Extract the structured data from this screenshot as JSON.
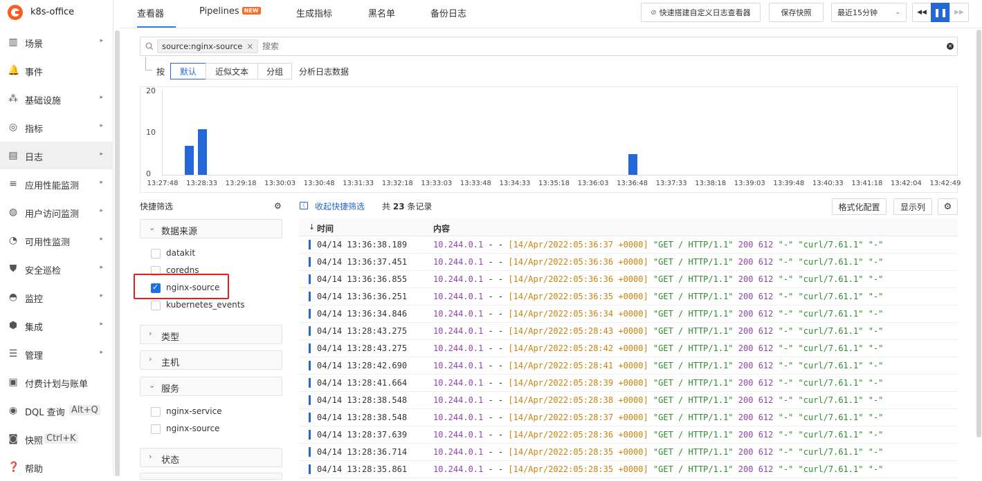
{
  "app": {
    "title": "k8s-office"
  },
  "sidebar": {
    "items": [
      {
        "label": "场景",
        "arrow": "▸"
      },
      {
        "label": "事件",
        "arrow": ""
      },
      {
        "label": "基础设施",
        "arrow": "▸"
      },
      {
        "label": "指标",
        "arrow": "▸"
      },
      {
        "label": "日志",
        "arrow": "▸"
      },
      {
        "label": "应用性能监测",
        "arrow": "▸"
      },
      {
        "label": "用户访问监测",
        "arrow": "▸"
      },
      {
        "label": "可用性监测",
        "arrow": "▸"
      },
      {
        "label": "安全巡检",
        "arrow": "▸"
      },
      {
        "label": "监控",
        "arrow": "▸"
      },
      {
        "label": "集成",
        "arrow": "▸"
      },
      {
        "label": "管理",
        "arrow": "▸"
      },
      {
        "label": "付费计划与账单",
        "arrow": ""
      },
      {
        "label": "DQL 查询",
        "shortcut": "Alt+Q",
        "arrow": ""
      },
      {
        "label": "快照",
        "shortcut": "Ctrl+K",
        "arrow": ""
      },
      {
        "label": "帮助",
        "arrow": ""
      }
    ],
    "active_index": 4
  },
  "header": {
    "tabs": [
      "查看器",
      "Pipelines",
      "生成指标",
      "黑名单",
      "备份日志"
    ],
    "new_badge": "NEW",
    "quick_build": "快速搭建自定义日志查看器",
    "save_snapshot": "保存快照",
    "time_range": "最近15分钟"
  },
  "search": {
    "tag": "source:nginx-source",
    "placeholder": "搜索"
  },
  "analysis": {
    "prefix": "按",
    "modes": [
      "默认",
      "近似文本",
      "分组"
    ],
    "suffix": "分析日志数据"
  },
  "chart_data": {
    "type": "bar",
    "yticks": [
      "20",
      "10",
      "0"
    ],
    "ylim": [
      0,
      20
    ],
    "xticks": [
      "13:27:48",
      "13:28:33",
      "13:29:18",
      "13:30:03",
      "13:30:48",
      "13:31:33",
      "13:32:18",
      "13:33:03",
      "13:33:48",
      "13:34:33",
      "13:35:18",
      "13:36:03",
      "13:36:48",
      "13:37:33",
      "13:38:18",
      "13:39:03",
      "13:39:48",
      "13:40:33",
      "13:41:18",
      "13:42:04",
      "13:42:49"
    ],
    "bars": [
      {
        "x": "13:28:18",
        "value": 7
      },
      {
        "x": "13:28:33",
        "value": 11
      },
      {
        "x": "13:36:48",
        "value": 5
      }
    ],
    "color": "#2467d6"
  },
  "quick_filter": {
    "title": "快捷筛选",
    "groups": [
      {
        "title": "数据来源",
        "expanded": true,
        "items": [
          {
            "label": "datakit",
            "checked": false
          },
          {
            "label": "coredns",
            "checked": false
          },
          {
            "label": "nginx-source",
            "checked": true
          },
          {
            "label": "kubernetes_events",
            "checked": false
          }
        ]
      },
      {
        "title": "类型",
        "expanded": false
      },
      {
        "title": "主机",
        "expanded": false
      },
      {
        "title": "服务",
        "expanded": true,
        "items": [
          {
            "label": "nginx-service",
            "checked": false
          },
          {
            "label": "nginx-source",
            "checked": false
          }
        ]
      },
      {
        "title": "状态",
        "expanded": false
      }
    ]
  },
  "logs": {
    "collapse_label": "收起快捷筛选",
    "count_prefix": "共",
    "count": "23",
    "count_suffix": "条记录",
    "format_button": "格式化配置",
    "columns_button": "显示列",
    "columns": [
      "时间",
      "内容"
    ],
    "rows": [
      {
        "time": "04/14 13:36:38.189",
        "ip": "10.244.0.1",
        "ts": "[14/Apr/2022:05:36:37 +0000]"
      },
      {
        "time": "04/14 13:36:37.451",
        "ip": "10.244.0.1",
        "ts": "[14/Apr/2022:05:36:36 +0000]"
      },
      {
        "time": "04/14 13:36:36.855",
        "ip": "10.244.0.1",
        "ts": "[14/Apr/2022:05:36:36 +0000]"
      },
      {
        "time": "04/14 13:36:36.251",
        "ip": "10.244.0.1",
        "ts": "[14/Apr/2022:05:36:35 +0000]"
      },
      {
        "time": "04/14 13:36:34.846",
        "ip": "10.244.0.1",
        "ts": "[14/Apr/2022:05:36:34 +0000]"
      },
      {
        "time": "04/14 13:28:43.275",
        "ip": "10.244.0.1",
        "ts": "[14/Apr/2022:05:28:43 +0000]"
      },
      {
        "time": "04/14 13:28:43.275",
        "ip": "10.244.0.1",
        "ts": "[14/Apr/2022:05:28:42 +0000]"
      },
      {
        "time": "04/14 13:28:42.690",
        "ip": "10.244.0.1",
        "ts": "[14/Apr/2022:05:28:41 +0000]"
      },
      {
        "time": "04/14 13:28:41.664",
        "ip": "10.244.0.1",
        "ts": "[14/Apr/2022:05:28:39 +0000]"
      },
      {
        "time": "04/14 13:28:38.548",
        "ip": "10.244.0.1",
        "ts": "[14/Apr/2022:05:28:38 +0000]"
      },
      {
        "time": "04/14 13:28:38.548",
        "ip": "10.244.0.1",
        "ts": "[14/Apr/2022:05:28:37 +0000]"
      },
      {
        "time": "04/14 13:28:37.639",
        "ip": "10.244.0.1",
        "ts": "[14/Apr/2022:05:28:36 +0000]"
      },
      {
        "time": "04/14 13:28:36.714",
        "ip": "10.244.0.1",
        "ts": "[14/Apr/2022:05:28:35 +0000]"
      },
      {
        "time": "04/14 13:28:35.861",
        "ip": "10.244.0.1",
        "ts": "[14/Apr/2022:05:28:35 +0000]"
      }
    ],
    "dash": "- -",
    "request": "\"GET / HTTP/1.1\"",
    "status": "200",
    "bytes": "612",
    "referer": "\"-\"",
    "agent": "\"curl/7.61.1\"",
    "forwarded": "\"-\"",
    "colors": {
      "ip": "#8e44ad",
      "ts": "#c8830d",
      "req": "#2e8b2e",
      "num": "#8e44ad"
    }
  }
}
